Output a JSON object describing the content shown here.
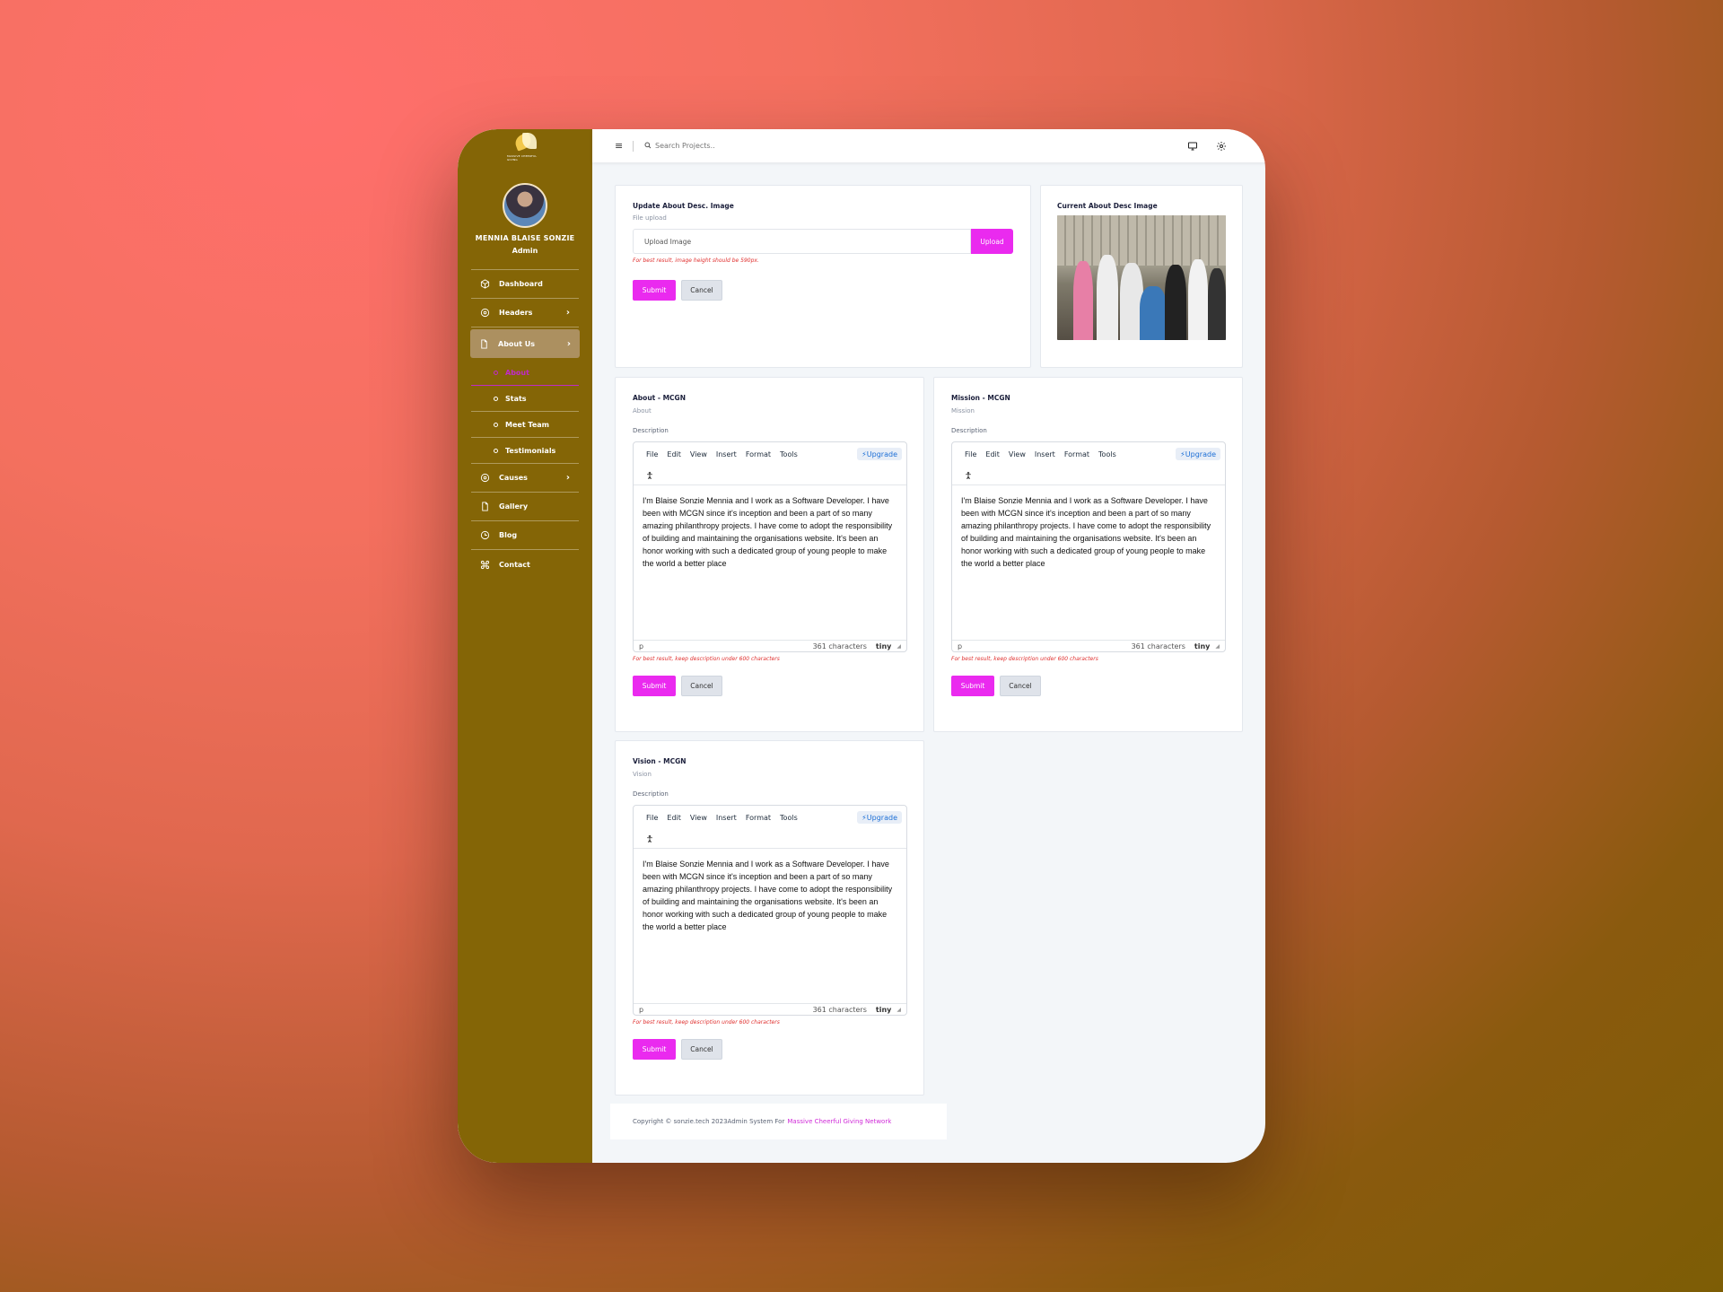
{
  "brand": {
    "logo_text": "MASSIVE CHEERFUL GIVING",
    "accent": "#ea2aef",
    "sidebar_color": "#846506"
  },
  "user": {
    "name": "MENNIA BLAISE SONZIE",
    "role": "Admin"
  },
  "sidebar": {
    "items": [
      {
        "label": "Dashboard",
        "icon": "cube-icon"
      },
      {
        "label": "Headers",
        "icon": "target-icon"
      },
      {
        "label": "About Us",
        "icon": "file-icon"
      },
      {
        "label": "Causes",
        "icon": "target-icon"
      },
      {
        "label": "Gallery",
        "icon": "file-icon"
      },
      {
        "label": "Blog",
        "icon": "clock-icon"
      },
      {
        "label": "Contact",
        "icon": "command-icon"
      }
    ],
    "sub_items": [
      "About",
      "Stats",
      "Meet Team",
      "Testimonials"
    ]
  },
  "topbar": {
    "search_placeholder": "Search Projects.."
  },
  "upload_card": {
    "title": "Update About Desc. Image",
    "subtitle": "File upload",
    "input_text": "Upload Image",
    "upload_label": "Upload",
    "hint": "For best result, image height should be 590px.",
    "submit": "Submit",
    "cancel": "Cancel"
  },
  "current_image_card": {
    "title": "Current About Desc Image"
  },
  "editor_menu": [
    "File",
    "Edit",
    "View",
    "Insert",
    "Format",
    "Tools"
  ],
  "editor_upgrade": "⚡Upgrade",
  "editors": [
    {
      "title": "About - MCGN",
      "subtitle": "About",
      "label": "Description",
      "body": "I'm Blaise Sonzie Mennia and I work as a Software Developer. I have been with MCGN since it's inception and been a part of so many amazing philanthropy projects. I have come to adopt the responsibility of building and maintaining the organisations website.  It's been an honor working with such a dedicated group of young people to make the world a better place",
      "path": "p",
      "chars": "361 characters",
      "hint": "For best result, keep description under 600 characters",
      "submit": "Submit",
      "cancel": "Cancel"
    },
    {
      "title": "Mission - MCGN",
      "subtitle": "Mission",
      "label": "Description",
      "body": "I'm Blaise Sonzie Mennia and I work as a Software Developer. I have been with MCGN since it's inception and been a part of so many amazing philanthropy projects. I have come to adopt the responsibility of building and maintaining the organisations website.  It's been an honor working with such a dedicated group of young people to make the world a better place",
      "path": "p",
      "chars": "361 characters",
      "hint": "For best result, keep description under 600 characters",
      "submit": "Submit",
      "cancel": "Cancel"
    },
    {
      "title": "Vision - MCGN",
      "subtitle": "Vision",
      "label": "Description",
      "body": "I'm Blaise Sonzie Mennia and I work as a Software Developer. I have been with MCGN since it's inception and been a part of so many amazing philanthropy projects. I have come to adopt the responsibility of building and maintaining the organisations website.  It's been an honor working with such a dedicated group of young people to make the world a better place",
      "path": "p",
      "chars": "361 characters",
      "hint": "For best result, keep description under 600 characters",
      "submit": "Submit",
      "cancel": "Cancel"
    }
  ],
  "tiny_brand": "tiny",
  "footer": {
    "text": "Copyright © sonzie.tech 2023Admin System For",
    "link": "Massive Cheerful Giving Network"
  }
}
